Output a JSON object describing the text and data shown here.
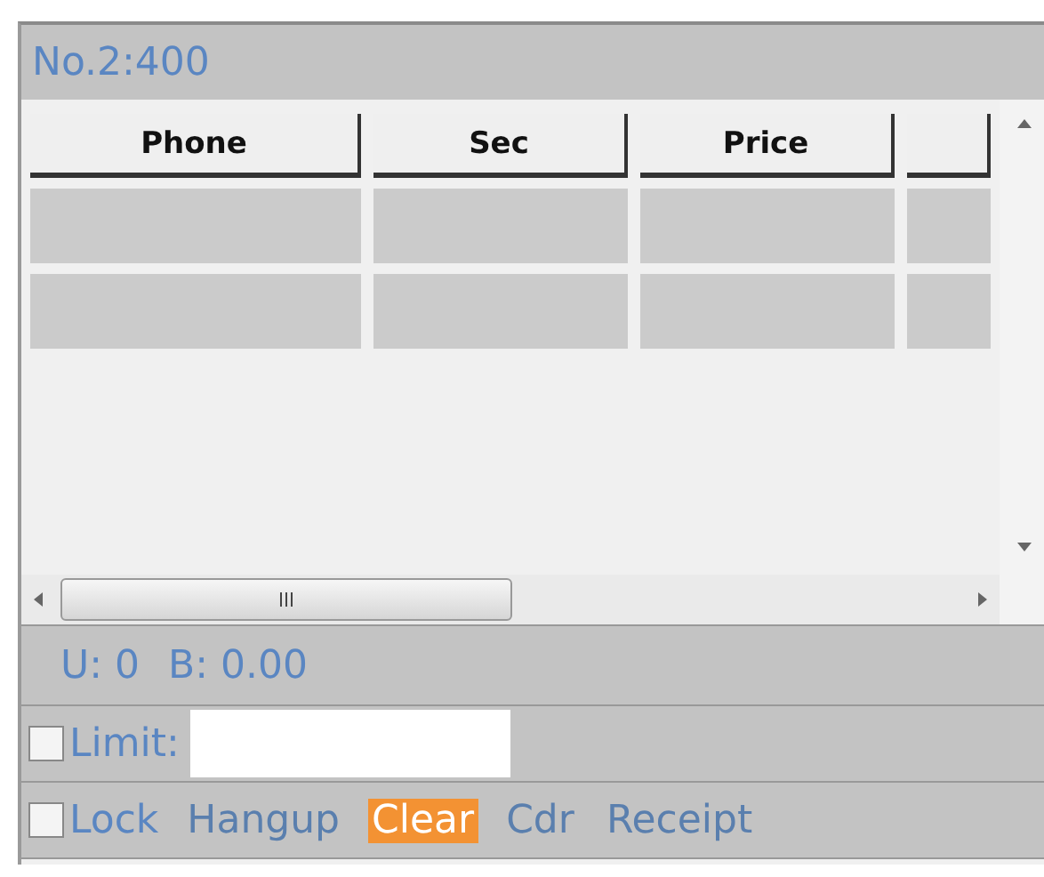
{
  "title": "No.2:400",
  "table": {
    "columns": [
      "Phone",
      "Sec",
      "Price"
    ]
  },
  "status": {
    "users": "U: 0",
    "balance": "B: 0.00"
  },
  "limit": {
    "label": "Limit:",
    "checked": false
  },
  "lock": {
    "label": "Lock",
    "checked": false
  },
  "actions": [
    {
      "label": "Hangup",
      "selected": false
    },
    {
      "label": "Clear",
      "selected": true
    },
    {
      "label": "Cdr",
      "selected": false
    },
    {
      "label": "Receipt",
      "selected": false
    }
  ]
}
